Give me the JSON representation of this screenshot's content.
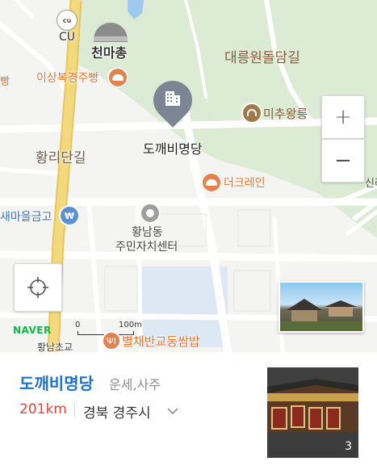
{
  "map": {
    "labels": {
      "cu": "CU",
      "cheonmachong": "천마총",
      "daereungwon_dolldam": "대릉원돌담길",
      "isangbok_bread": "이상복경주빵",
      "michu_tomb": "미추왕릉",
      "hwangridan": "황리단길",
      "dokkaebi": "도깨비명당",
      "the_crane": "더크레인",
      "saemaeul": "새마을금고",
      "hwangnam_center_1": "황남동",
      "hwangnam_center_2": "주민자치센터",
      "hwangnam_school": "황남초교",
      "byeolchae": "별채반교동쌈밥",
      "cut_left": "빵",
      "cut_right": "신라"
    },
    "brand": "NAVER",
    "scale": {
      "zero": "0",
      "distance": "100m"
    },
    "controls": {
      "zoom_in": "+",
      "zoom_out": "−"
    }
  },
  "place": {
    "name": "도깨비명당",
    "category": "운세,사주",
    "distance": "201km",
    "region": "경북 경주시",
    "photo_count": "3"
  },
  "colors": {
    "park_green": "#dcebd4",
    "road_yellow": "#f3d97d",
    "poi_orange": "#e3824e",
    "marker_gray": "#7c8594",
    "title_blue": "#1a73c9",
    "distance_red": "#e0443a",
    "naver_green": "#19b24a"
  }
}
